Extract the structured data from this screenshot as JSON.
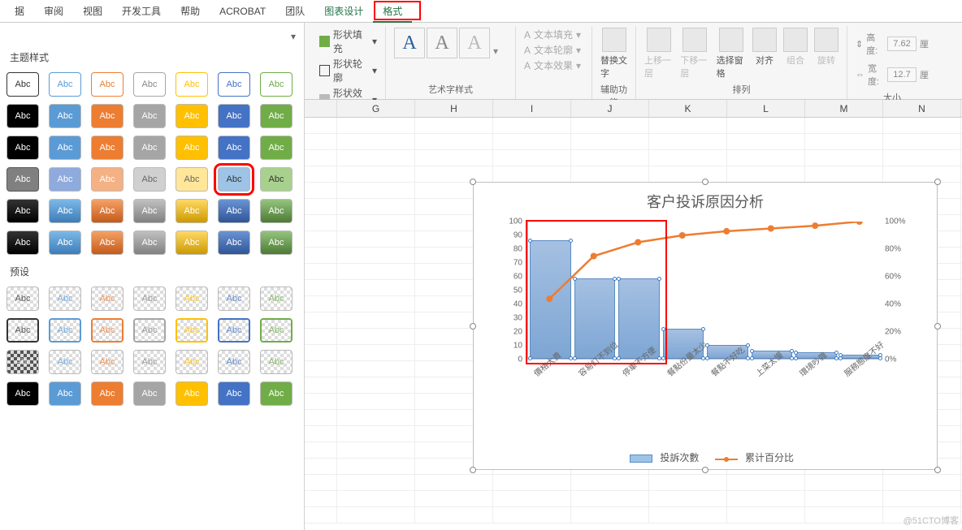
{
  "tabs": {
    "items": [
      "据",
      "审阅",
      "视图",
      "开发工具",
      "帮助",
      "ACROBAT",
      "团队",
      "图表设计",
      "格式"
    ]
  },
  "panel": {
    "theme_title": "主题样式",
    "preset_title": "预设",
    "swatch_text": "Abc",
    "row1": [
      "#000000",
      "#5b9bd5",
      "#ed7d31",
      "#a5a5a5",
      "#ffc000",
      "#4472c4",
      "#70ad47"
    ],
    "row2": [
      "#000000",
      "#5b9bd5",
      "#ed7d31",
      "#a5a5a5",
      "#ffc000",
      "#4472c4",
      "#70ad47"
    ],
    "row3": [
      "#595959",
      "#8faadc",
      "#f4b183",
      "#c9c9c9",
      "#ffe699",
      "#9dc3e6",
      "#a9d18e"
    ],
    "row4": [
      "#000000",
      "#5b9bd5",
      "#ed7d31",
      "#a5a5a5",
      "#ffc000",
      "#4472c4",
      "#70ad47"
    ],
    "row5": [
      "#000000",
      "#5b9bd5",
      "#ed7d31",
      "#a5a5a5",
      "#ffc000",
      "#4472c4",
      "#70ad47"
    ],
    "outline_colors": [
      "#333",
      "#5b9bd5",
      "#ed7d31",
      "#a5a5a5",
      "#ffc000",
      "#4472c4",
      "#70ad47"
    ]
  },
  "ribbon": {
    "shape_fill": "形状填充",
    "shape_outline": "形状轮廓",
    "shape_effects": "形状效果",
    "wordart_label": "艺术字样式",
    "text_fill": "文本填充",
    "text_outline": "文本轮廓",
    "text_effects": "文本效果",
    "alt_text": "替换文字",
    "accessibility": "辅助功能",
    "bring_forward": "上移一层",
    "send_backward": "下移一层",
    "selection_pane": "选择窗格",
    "align": "对齐",
    "group": "组合",
    "rotate": "旋转",
    "arrange": "排列",
    "height_lbl": "高度:",
    "width_lbl": "宽度:",
    "height_val": "7.62",
    "width_val": "12.7",
    "unit": "厘",
    "size": "大小"
  },
  "columns": [
    "G",
    "H",
    "I",
    "J",
    "K",
    "L",
    "M",
    "N"
  ],
  "chart_data": {
    "type": "pareto",
    "title": "客户投诉原因分析",
    "categories": [
      "價格太貴",
      "容易訂不到位",
      "停車不方便",
      "餐點份量太少",
      "餐點不好吃",
      "上菜太慢",
      "環境吵雜",
      "服務態度不好"
    ],
    "series": [
      {
        "name": "投訴次數",
        "type": "bar",
        "values": [
          86,
          58,
          58,
          22,
          10,
          6,
          5,
          3
        ]
      },
      {
        "name": "累计百分比",
        "type": "line",
        "values": [
          44,
          75,
          85,
          90,
          93,
          95,
          97,
          100
        ]
      }
    ],
    "ylabel": "",
    "ylim": [
      0,
      100
    ],
    "yticks": [
      0,
      10,
      20,
      30,
      40,
      50,
      60,
      70,
      80,
      90,
      100
    ],
    "y2lim": [
      0,
      100
    ],
    "y2ticks": [
      0,
      20,
      40,
      60,
      80,
      100
    ],
    "y2format": "%",
    "legend": [
      "投訴次數",
      "累计百分比"
    ]
  },
  "watermark": "@51CTO博客"
}
